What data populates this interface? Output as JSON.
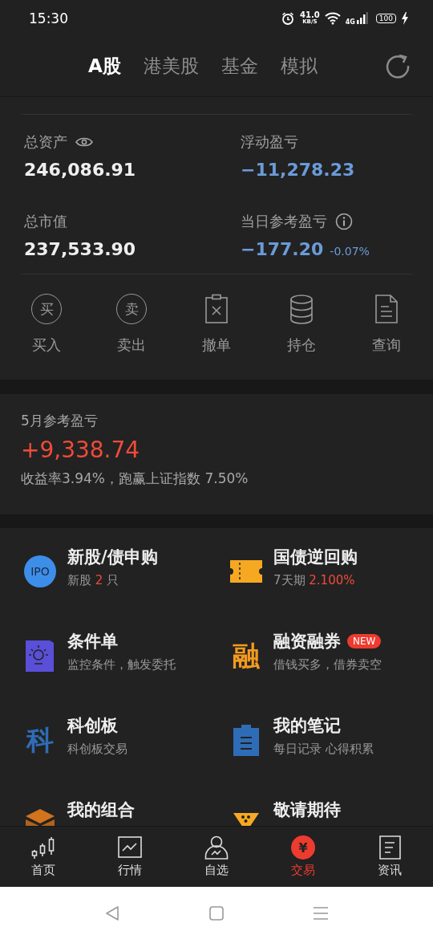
{
  "status_bar": {
    "time": "15:30",
    "speed": "41.0",
    "speed_unit": "KB/S",
    "network": "4G",
    "battery": "100"
  },
  "tabs": [
    {
      "label": "A股",
      "selected": true
    },
    {
      "label": "港美股",
      "selected": false
    },
    {
      "label": "基金",
      "selected": false
    },
    {
      "label": "模拟",
      "selected": false
    }
  ],
  "summary": [
    {
      "label": "总资产",
      "kind": "eye",
      "value": "246,086.91",
      "color": "#eeeeee"
    },
    {
      "label": "浮动盈亏",
      "kind": "plain",
      "value": "−11,278.23",
      "color": "#6b9bd8"
    },
    {
      "label": "总市值",
      "kind": "plain",
      "value": "237,533.90",
      "color": "#eeeeee"
    },
    {
      "label": "当日参考盈亏",
      "kind": "info",
      "value": "−177.20",
      "change": "-0.07%",
      "color": "#6b9bd8"
    }
  ],
  "actions": [
    {
      "label": "买入",
      "kind": "circle",
      "glyph": "买"
    },
    {
      "label": "卖出",
      "kind": "circle",
      "glyph": "卖"
    },
    {
      "label": "撤单",
      "kind": "cancel"
    },
    {
      "label": "持仓",
      "kind": "database"
    },
    {
      "label": "查询",
      "kind": "document"
    }
  ],
  "monthly": {
    "title": "5月参考盈亏",
    "value": "+9,338.74",
    "note": "收益率3.94%，跑赢上证指数 7.50%"
  },
  "services": [
    {
      "title": "新股/债申购",
      "kind": "ipo",
      "glyph": "IPO",
      "sub": "新股 ",
      "sub_value": "2",
      "sub_after": " 只"
    },
    {
      "title": "国债逆回购",
      "kind": "ticket",
      "sub": "7天期 ",
      "sub_value": "2.100%"
    },
    {
      "title": "条件单",
      "kind": "bulb",
      "sub": "监控条件，触发委托"
    },
    {
      "title": "融资融券",
      "kind": "glyph-orange",
      "glyph": "融",
      "badge": "NEW",
      "sub": "借钱买多，借券卖空"
    },
    {
      "title": "科创板",
      "kind": "glyph-blue",
      "glyph": "科",
      "sub": "科创板交易"
    },
    {
      "title": "我的笔记",
      "kind": "clipboard",
      "sub": "每日记录 心得积累"
    },
    {
      "title": "我的组合",
      "kind": "box"
    },
    {
      "title": "敬请期待",
      "kind": "cup"
    }
  ],
  "bottom_nav": [
    {
      "label": "首页",
      "kind": "candles",
      "selected": false
    },
    {
      "label": "行情",
      "kind": "chart",
      "selected": false
    },
    {
      "label": "自选",
      "kind": "person",
      "selected": false
    },
    {
      "label": "交易",
      "kind": "yen",
      "glyph": "¥",
      "selected": true
    },
    {
      "label": "资讯",
      "kind": "news",
      "selected": false
    }
  ]
}
